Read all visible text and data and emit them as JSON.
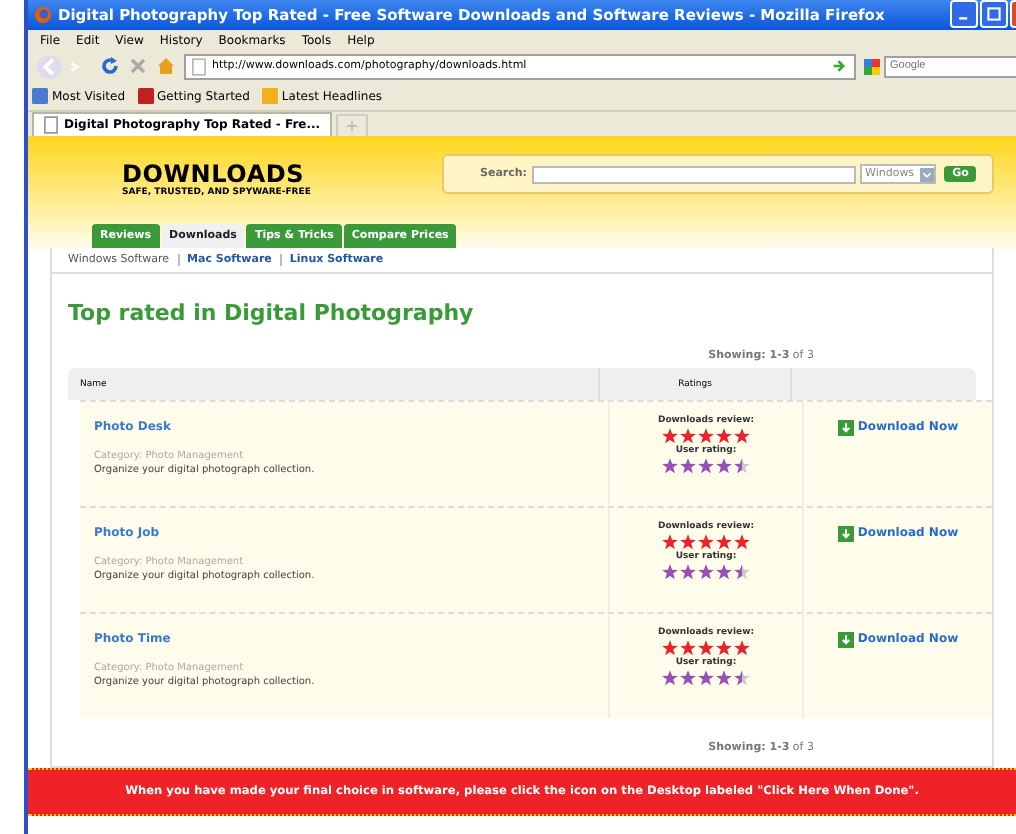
{
  "window": {
    "title": "Digital Photography Top Rated - Free Software Downloads and Software Reviews - Mozilla Firefox"
  },
  "menu": [
    "File",
    "Edit",
    "View",
    "History",
    "Bookmarks",
    "Tools",
    "Help"
  ],
  "address": {
    "value": "http://www.downloads.com/photography/downloads.html"
  },
  "search_engine": {
    "placeholder": "Google"
  },
  "bookmarks": [
    "Most Visited",
    "Getting Started",
    "Latest Headlines"
  ],
  "browser_tabs": [
    {
      "label": "Digital Photography Top Rated - Fre...",
      "selected": true
    }
  ],
  "site": {
    "logo": "DOWNLOADS",
    "tagline": "SAFE, TRUSTED, AND SPYWARE-FREE",
    "search_label": "Search:",
    "platform": "Windows",
    "go": "Go"
  },
  "site_tabs": [
    {
      "label": "Reviews",
      "selected": false
    },
    {
      "label": "Downloads",
      "selected": true
    },
    {
      "label": "Tips & Tricks",
      "selected": false
    },
    {
      "label": "Compare Prices",
      "selected": false
    }
  ],
  "subnav": [
    {
      "label": "Windows Software",
      "selected": true
    },
    {
      "label": "Mac Software",
      "selected": false
    },
    {
      "label": "Linux Software",
      "selected": false
    }
  ],
  "heading": "Top rated in Digital Photography",
  "showing_top": "**Showing: 1-3** of 3",
  "columns": [
    "Name",
    "Ratings"
  ],
  "rows": [
    {
      "name": "Photo Desk",
      "category": "Category: Photo Management",
      "description": "Organize your digital photograph collection.",
      "review": {
        "label": "Downloads review:",
        "stars": 5
      },
      "user_rating": {
        "label": "User rating:",
        "stars": 4.5
      },
      "action": "Download Now"
    },
    {
      "name": "Photo Job",
      "category": "Category: Photo Management",
      "description": "Organize your digital photograph collection.",
      "review": {
        "label": "Downloads review:",
        "stars": 5
      },
      "user_rating": {
        "label": "User rating:",
        "stars": 4.5
      },
      "action": "Download Now"
    },
    {
      "name": "Photo Time",
      "category": "Category: Photo Management",
      "description": "Organize your digital photograph collection.",
      "review": {
        "label": "Downloads review:",
        "stars": 5
      },
      "user_rating": {
        "label": "User rating:",
        "stars": 4.5
      },
      "action": "Download Now"
    }
  ],
  "showing_bottom": "**Showing: 1-3** of 3",
  "banner": "When you have made your final choice in software, please click the icon on the Desktop labeled \"Click Here When Done\"."
}
